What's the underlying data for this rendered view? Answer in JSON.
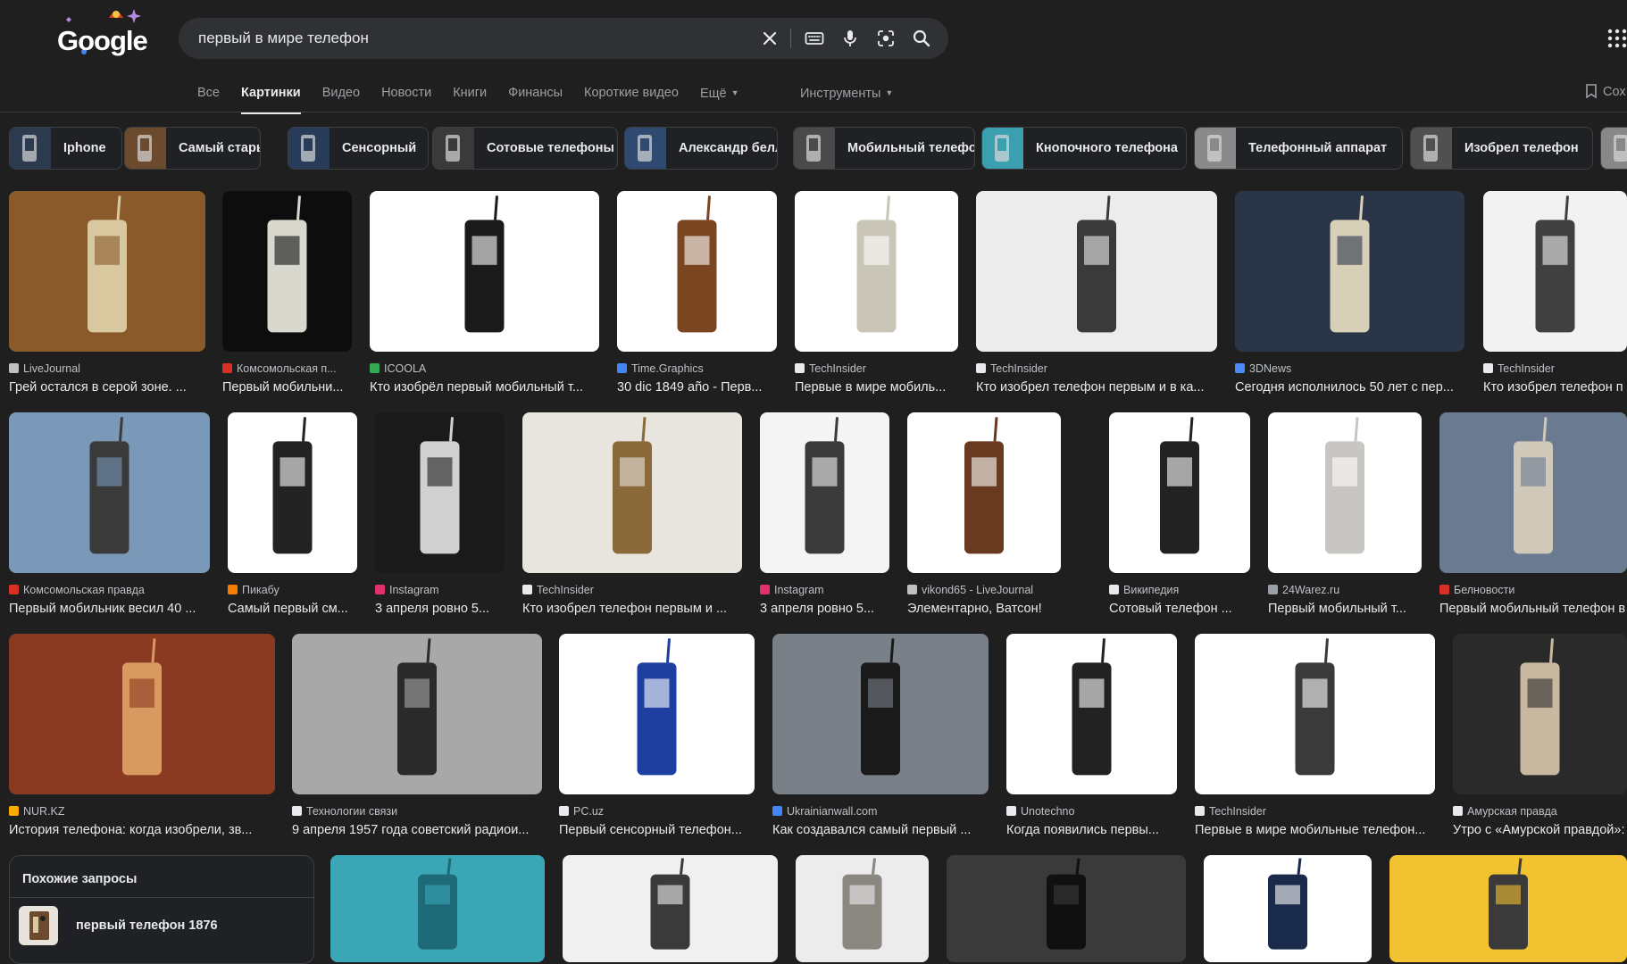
{
  "search": {
    "query": "первый в мире телефон"
  },
  "logo": {
    "text": "Google"
  },
  "tabs": [
    {
      "label": "Все",
      "active": false
    },
    {
      "label": "Картинки",
      "active": true
    },
    {
      "label": "Видео",
      "active": false
    },
    {
      "label": "Новости",
      "active": false
    },
    {
      "label": "Книги",
      "active": false
    },
    {
      "label": "Финансы",
      "active": false
    },
    {
      "label": "Короткие видео",
      "active": false
    },
    {
      "label": "Ещё",
      "active": false
    }
  ],
  "tools_label": "Инструменты",
  "save_label": "Сох",
  "chips": [
    {
      "label": "Iphone",
      "color": "#2b3a4e"
    },
    {
      "label": "Самый старый",
      "color": "#6b4a2e"
    },
    {
      "label": "Сенсорный",
      "color": "#283c5a"
    },
    {
      "label": "Сотовые телефоны",
      "color": "#3a3a3a"
    },
    {
      "label": "Александр белл",
      "color": "#2e4a70"
    },
    {
      "label": "Мобильный телефон",
      "color": "#4a4a4a"
    },
    {
      "label": "Кнопочного телефона",
      "color": "#3a9fae"
    },
    {
      "label": "Телефонный аппарат",
      "color": "#8a8a8a"
    },
    {
      "label": "Изобрел телефон",
      "color": "#505050"
    },
    {
      "label": "",
      "color": "#888888"
    }
  ],
  "images": {
    "row1": [
      {
        "source": "LiveJournal",
        "title": "Грей остался в серой зоне. ...",
        "bg": "#8b5a2b",
        "fg": "#d8c9a0",
        "icon": "#c0c0c0"
      },
      {
        "source": "Комсомольская п...",
        "title": "Первый мобильни...",
        "bg": "#0d0d0d",
        "fg": "#d8d8cf",
        "icon": "#d93025"
      },
      {
        "source": "ICOOLA",
        "title": "Кто изобрёл первый мобильный т...",
        "bg": "#ffffff",
        "fg": "#1a1a1a",
        "icon": "#34a853"
      },
      {
        "source": "Time.Graphics",
        "title": "30 dic 1849 año - Перв...",
        "bg": "#ffffff",
        "fg": "#7a4520",
        "icon": "#4285f4"
      },
      {
        "source": "TechInsider",
        "title": "Первые в мире мобиль...",
        "bg": "#ffffff",
        "fg": "#c9c6b8",
        "icon": "#e8eaed"
      },
      {
        "source": "TechInsider",
        "title": "Кто изобрел телефон первым и в ка...",
        "bg": "#ececec",
        "fg": "#3a3a3a",
        "icon": "#e8eaed"
      },
      {
        "source": "3DNews",
        "title": "Сегодня исполнилось 50 лет с пер...",
        "bg": "#2a3548",
        "fg": "#d8cfb8",
        "icon": "#4a8af4"
      },
      {
        "source": "TechInsider",
        "title": "Кто изобрел телефон п",
        "bg": "#f2f2f2",
        "fg": "#404040",
        "icon": "#e8eaed"
      }
    ],
    "row2": [
      {
        "source": "Комсомольская правда",
        "title": "Первый мобильник весил 40 ...",
        "bg": "#7a98b8",
        "fg": "#3a3a3a",
        "icon": "#d93025"
      },
      {
        "source": "Пикабу",
        "title": "Самый первый см...",
        "bg": "#ffffff",
        "fg": "#222222",
        "icon": "#f57c00"
      },
      {
        "source": "Instagram",
        "title": "3 апреля ровно 5...",
        "bg": "#1a1a1a",
        "fg": "#d0d0d0",
        "icon": "#e1306c"
      },
      {
        "source": "TechInsider",
        "title": "Кто изобрел телефон первым и ...",
        "bg": "#e8e4de",
        "fg": "#8a6a3a",
        "icon": "#e8eaed"
      },
      {
        "source": "Instagram",
        "title": "3 апреля ровно 5...",
        "bg": "#f4f4f4",
        "fg": "#3a3a3a",
        "icon": "#e1306c"
      },
      {
        "source": "vikond65 - LiveJournal",
        "title": "Элементарно, Ватсон!",
        "bg": "#ffffff",
        "fg": "#6a3a20",
        "icon": "#c0c0c0"
      },
      {
        "source": "Википедия",
        "title": "Сотовый телефон ...",
        "bg": "#ffffff",
        "fg": "#222222",
        "icon": "#e8eaed"
      },
      {
        "source": "24Warez.ru",
        "title": "Первый мобильный т...",
        "bg": "#ffffff",
        "fg": "#c8c6c2",
        "icon": "#9aa0a6"
      },
      {
        "source": "Белновости",
        "title": "Первый мобильный телефон в",
        "bg": "#6a7a90",
        "fg": "#d0c8b8",
        "icon": "#d93025"
      }
    ],
    "row3": [
      {
        "source": "NUR.KZ",
        "title": "История телефона: когда изобрели, зв...",
        "bg": "#8a3a20",
        "fg": "#d89a60",
        "icon": "#f9ab00"
      },
      {
        "source": "Технологии связи",
        "title": "9 апреля 1957 года советский радиои...",
        "bg": "#a8a8a8",
        "fg": "#2a2a2a",
        "icon": "#e8eaed"
      },
      {
        "source": "PC.uz",
        "title": "Первый сенсорный телефон...",
        "bg": "#ffffff",
        "fg": "#1f3fa0",
        "icon": "#e8eaed"
      },
      {
        "source": "Ukrainianwall.com",
        "title": "Как создавался самый первый ...",
        "bg": "#7a8088",
        "fg": "#1a1a1a",
        "icon": "#4285f4"
      },
      {
        "source": "Unotechno",
        "title": "Когда появились первы...",
        "bg": "#ffffff",
        "fg": "#222222",
        "icon": "#e8eaed"
      },
      {
        "source": "TechInsider",
        "title": "Первые в мире мобильные телефон...",
        "bg": "#ffffff",
        "fg": "#3a3a3a",
        "icon": "#e8eaed"
      },
      {
        "source": "Амурская правда",
        "title": "Утро с «Амурской правдой»:",
        "bg": "#2a2a2a",
        "fg": "#c8b8a0",
        "icon": "#e8eaed"
      }
    ],
    "row4": [
      {
        "bg": "#3aa6b6",
        "fg": "#1f6a78"
      },
      {
        "bg": "#f0f0f0",
        "fg": "#3a3a3a"
      },
      {
        "bg": "#ececec",
        "fg": "#8a8680"
      },
      {
        "bg": "#3a3a3a",
        "fg": "#101010"
      },
      {
        "bg": "#ffffff",
        "fg": "#1a2a4a"
      },
      {
        "bg": "#f2c230",
        "fg": "#3a3a3a"
      }
    ]
  },
  "related": {
    "title": "Похожие запросы",
    "item": "первый телефон 1876"
  }
}
